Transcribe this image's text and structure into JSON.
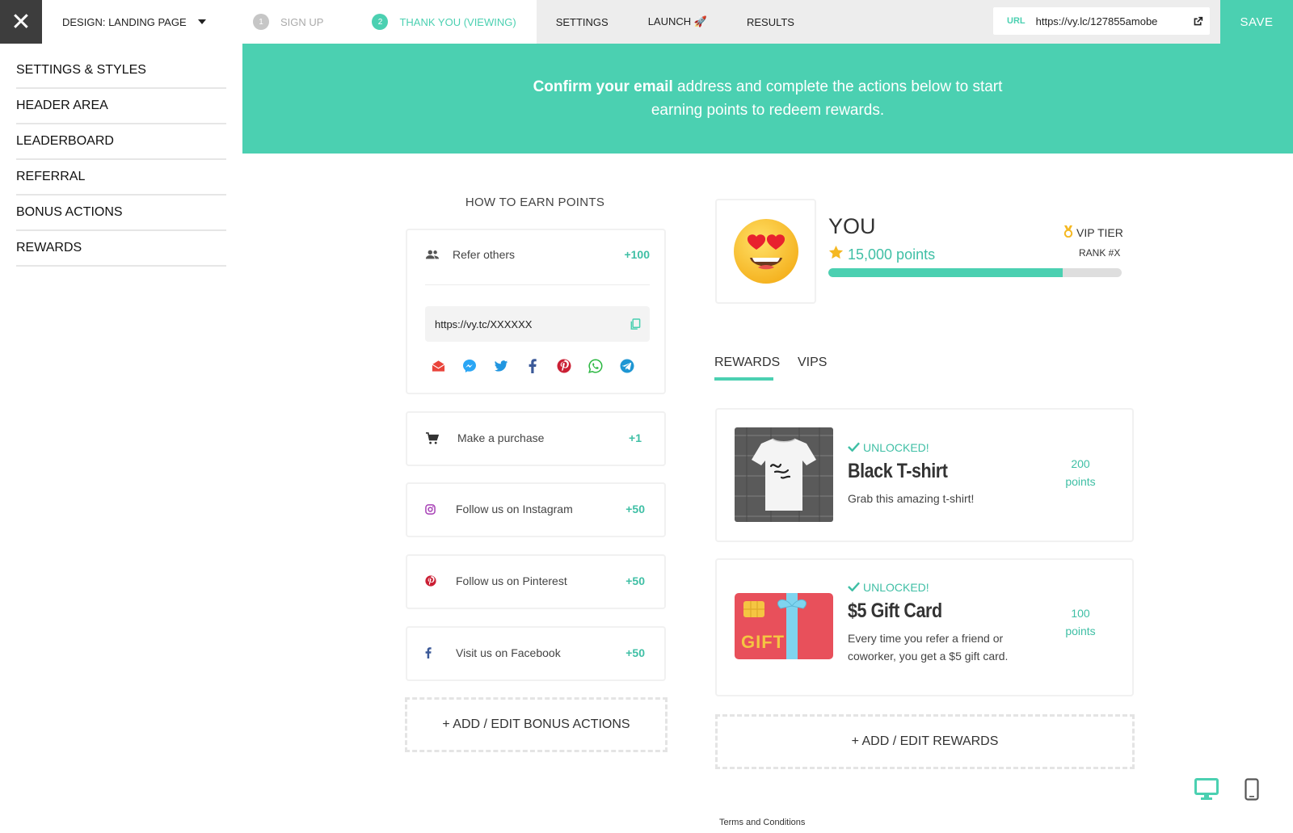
{
  "topbar": {
    "close_label": "✕",
    "design_label": "DESIGN: LANDING PAGE",
    "steps": [
      {
        "num": "1",
        "label": "SIGN UP"
      },
      {
        "num": "2",
        "label": "THANK YOU (VIEWING)"
      }
    ],
    "nav": [
      "SETTINGS",
      "LAUNCH 🚀",
      "RESULTS"
    ],
    "url_label": "URL",
    "url_value": "https://vy.lc/127855amobe",
    "save_label": "SAVE"
  },
  "sidebar": {
    "items": [
      {
        "label": "SETTINGS & STYLES"
      },
      {
        "label": "HEADER AREA"
      },
      {
        "label": "LEADERBOARD"
      },
      {
        "label": "REFERRAL"
      },
      {
        "label": "BONUS ACTIONS"
      },
      {
        "label": "REWARDS"
      }
    ]
  },
  "banner": {
    "bold": "Confirm your email",
    "rest": " address and complete the actions below to start earning points to redeem rewards."
  },
  "earn": {
    "title": "HOW TO EARN POINTS",
    "refer": {
      "label": "Refer others",
      "points": "+100",
      "link": "https://vy.tc/XXXXXX"
    },
    "share_icons": [
      "email-icon",
      "messenger-icon",
      "twitter-icon",
      "facebook-icon",
      "pinterest-icon",
      "whatsapp-icon",
      "telegram-icon"
    ],
    "actions": [
      {
        "label": "Make a purchase",
        "points": "+1",
        "icon": "cart-icon"
      },
      {
        "label": "Follow us on Instagram",
        "points": "+50",
        "icon": "instagram-icon"
      },
      {
        "label": "Follow us on Pinterest",
        "points": "+50",
        "icon": "pinterest-icon"
      },
      {
        "label": "Visit us on Facebook",
        "points": "+50",
        "icon": "facebook-icon"
      }
    ],
    "add_edit_label": "+ ADD / EDIT BONUS ACTIONS"
  },
  "profile": {
    "name": "YOU",
    "points": "15,000 points",
    "tier": "VIP TIER",
    "rank": "RANK #X",
    "progress": 0.8
  },
  "tabs": {
    "rewards": "REWARDS",
    "vips": "VIPS"
  },
  "rewards": {
    "items": [
      {
        "status": "UNLOCKED!",
        "name": "Black T-shirt",
        "desc": "Grab this amazing t-shirt!",
        "points_value": "200",
        "points_unit": "points"
      },
      {
        "status": "UNLOCKED!",
        "name": "$5 Gift Card",
        "desc": "Every time you refer a friend or coworker, you get a $5 gift card.",
        "points_value": "100",
        "points_unit": "points",
        "image_text": "GIFT"
      }
    ],
    "add_edit_label": "+ ADD / EDIT REWARDS"
  },
  "footer": {
    "terms": "Terms and Conditions"
  },
  "colors": {
    "accent": "#4bd0b1",
    "accent_text": "#3fbfa5",
    "dark": "#3d3d3d"
  }
}
